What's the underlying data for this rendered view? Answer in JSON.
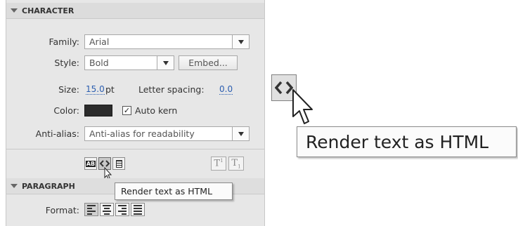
{
  "character": {
    "header": "CHARACTER",
    "family_label": "Family:",
    "family_value": "Arial",
    "style_label": "Style:",
    "style_value": "Bold",
    "embed_button": "Embed...",
    "size_label": "Size:",
    "size_value": "15.0",
    "size_unit": "pt",
    "letter_spacing_label": "Letter spacing:",
    "letter_spacing_value": "0.0",
    "color_label": "Color:",
    "color_value": "#2b2b2b",
    "auto_kern_label": "Auto kern",
    "auto_kern_checked": true,
    "anti_alias_label": "Anti-alias:",
    "anti_alias_value": "Anti-alias for readability"
  },
  "text_options": {
    "selectable_icon": "selectable-text-icon",
    "render_html_icon": "render-as-html-icon",
    "border_icon": "show-border-icon",
    "superscript_icon": "superscript-icon",
    "subscript_icon": "subscript-icon",
    "superscript_label": "T",
    "subscript_label": "T",
    "superscript_mark": "1",
    "subscript_mark": "1"
  },
  "tooltip": {
    "text": "Render text as HTML"
  },
  "paragraph": {
    "header": "PARAGRAPH",
    "format_label": "Format:"
  },
  "zoom": {
    "tooltip_text": "Render text as HTML"
  }
}
